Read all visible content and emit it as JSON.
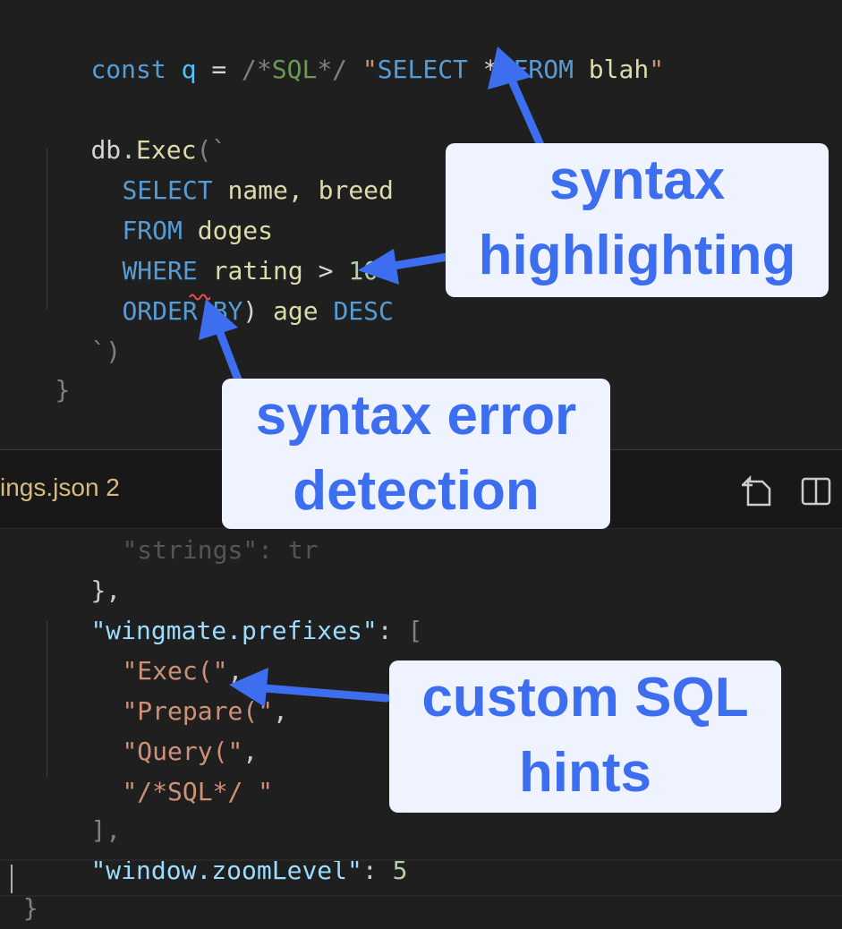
{
  "editor_top": {
    "line1": {
      "kw": "const",
      "var": "q",
      "op": "=",
      "comment": "/*SQL*/",
      "str_open": "\"",
      "sql_select": "SELECT",
      "sql_star": "*",
      "sql_from": "FROM",
      "sql_table": "blah",
      "str_close": "\""
    },
    "line2": {
      "obj": "db",
      "dot": ".",
      "fn": "Exec",
      "open": "(`"
    },
    "line3": {
      "kw": "SELECT",
      "rest": "name, breed"
    },
    "line4": {
      "kw": "FROM",
      "rest": "doges"
    },
    "line5": {
      "kw": "WHERE",
      "field": "rating",
      "op": ">",
      "num": "10"
    },
    "line6": {
      "kw": "ORDER BY",
      "err": ")",
      "field": "age",
      "kw2": "DESC"
    },
    "line7": {
      "close": "`)"
    },
    "line8": {
      "brace": "}"
    }
  },
  "tab_bar": {
    "file_tab_label": "ings.json 2",
    "open_changes_icon": "open-changes-icon",
    "split_editor_icon": "split-editor-icon"
  },
  "editor_bottom": {
    "partial_line": "\"strings\": tr",
    "line1": "},",
    "line2": {
      "key": "\"wingmate.prefixes\"",
      "colon": ":",
      "bracket": "["
    },
    "items": [
      {
        "value": "\"Exec(\"",
        "comma": ","
      },
      {
        "value": "\"Prepare(\"",
        "comma": ","
      },
      {
        "value": "\"Query(\"",
        "comma": ","
      },
      {
        "value": "\"/*SQL*/ \"",
        "comma": ""
      }
    ],
    "line_close": "],",
    "line_zoom": {
      "key": "\"window.zoomLevel\"",
      "colon": ":",
      "num": "5"
    },
    "line_end": "}"
  },
  "callouts": {
    "syntax_highlighting": "syntax\nhighlighting",
    "syntax_error_detection": "syntax error\ndetection",
    "custom_sql_hints": "custom SQL\nhints"
  },
  "colors": {
    "callout_text": "#3d6ef0",
    "callout_bg": "#eef3ff",
    "arrow": "#3d6ef0",
    "squiggle": "#f14c4c"
  }
}
